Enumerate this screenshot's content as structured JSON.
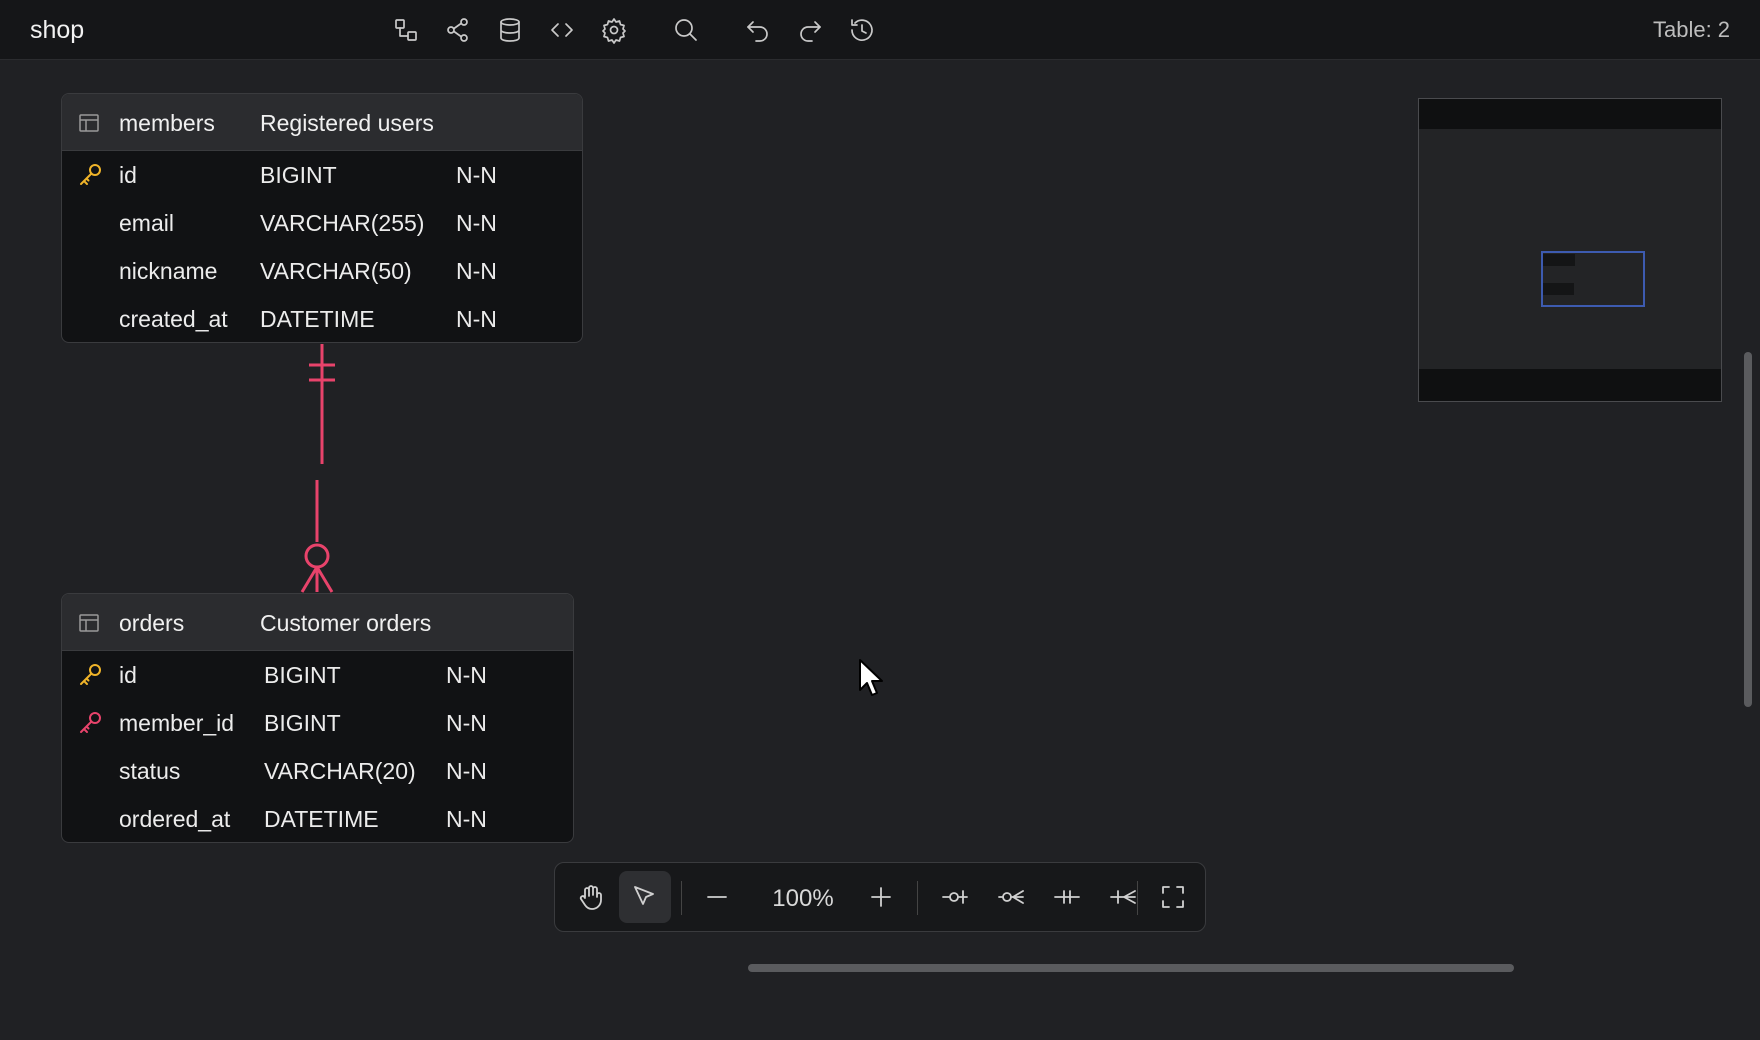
{
  "header": {
    "title": "shop",
    "table_count_label": "Table:",
    "table_count": "2",
    "icons": [
      "diagram-icon",
      "share-icon",
      "database-icon",
      "code-icon",
      "gear-icon",
      "search-icon",
      "undo-icon",
      "redo-icon",
      "history-icon"
    ]
  },
  "tables": [
    {
      "name": "members",
      "comment": "Registered users",
      "columns": [
        {
          "name": "id",
          "type": "BIGINT",
          "nullability": "N-N",
          "key": "primary"
        },
        {
          "name": "email",
          "type": "VARCHAR(255)",
          "nullability": "N-N",
          "key": ""
        },
        {
          "name": "nickname",
          "type": "VARCHAR(50)",
          "nullability": "N-N",
          "key": ""
        },
        {
          "name": "created_at",
          "type": "DATETIME",
          "nullability": "N-N",
          "key": ""
        }
      ]
    },
    {
      "name": "orders",
      "comment": "Customer orders",
      "columns": [
        {
          "name": "id",
          "type": "BIGINT",
          "nullability": "N-N",
          "key": "primary"
        },
        {
          "name": "member_id",
          "type": "BIGINT",
          "nullability": "N-N",
          "key": "foreign"
        },
        {
          "name": "status",
          "type": "VARCHAR(20)",
          "nullability": "N-N",
          "key": ""
        },
        {
          "name": "ordered_at",
          "type": "DATETIME",
          "nullability": "N-N",
          "key": ""
        }
      ]
    }
  ],
  "relationship": {
    "from": "members",
    "to": "orders",
    "from_cardinality": "one-and-only-one",
    "to_cardinality": "zero-or-many"
  },
  "toolbar": {
    "zoom": "100%",
    "tools": [
      "hand-icon",
      "pointer-icon",
      "zoom-out-icon",
      "zoom-in-icon",
      "zero-or-one-icon",
      "zero-or-many-icon",
      "one-only-icon",
      "one-or-many-icon",
      "fullscreen-icon"
    ]
  },
  "colors": {
    "background": "#202124",
    "primary_key": "#f0b429",
    "foreign_key": "#e8436b",
    "relation_line": "#e8436b",
    "minimap_viewport": "#3d5bb0"
  }
}
